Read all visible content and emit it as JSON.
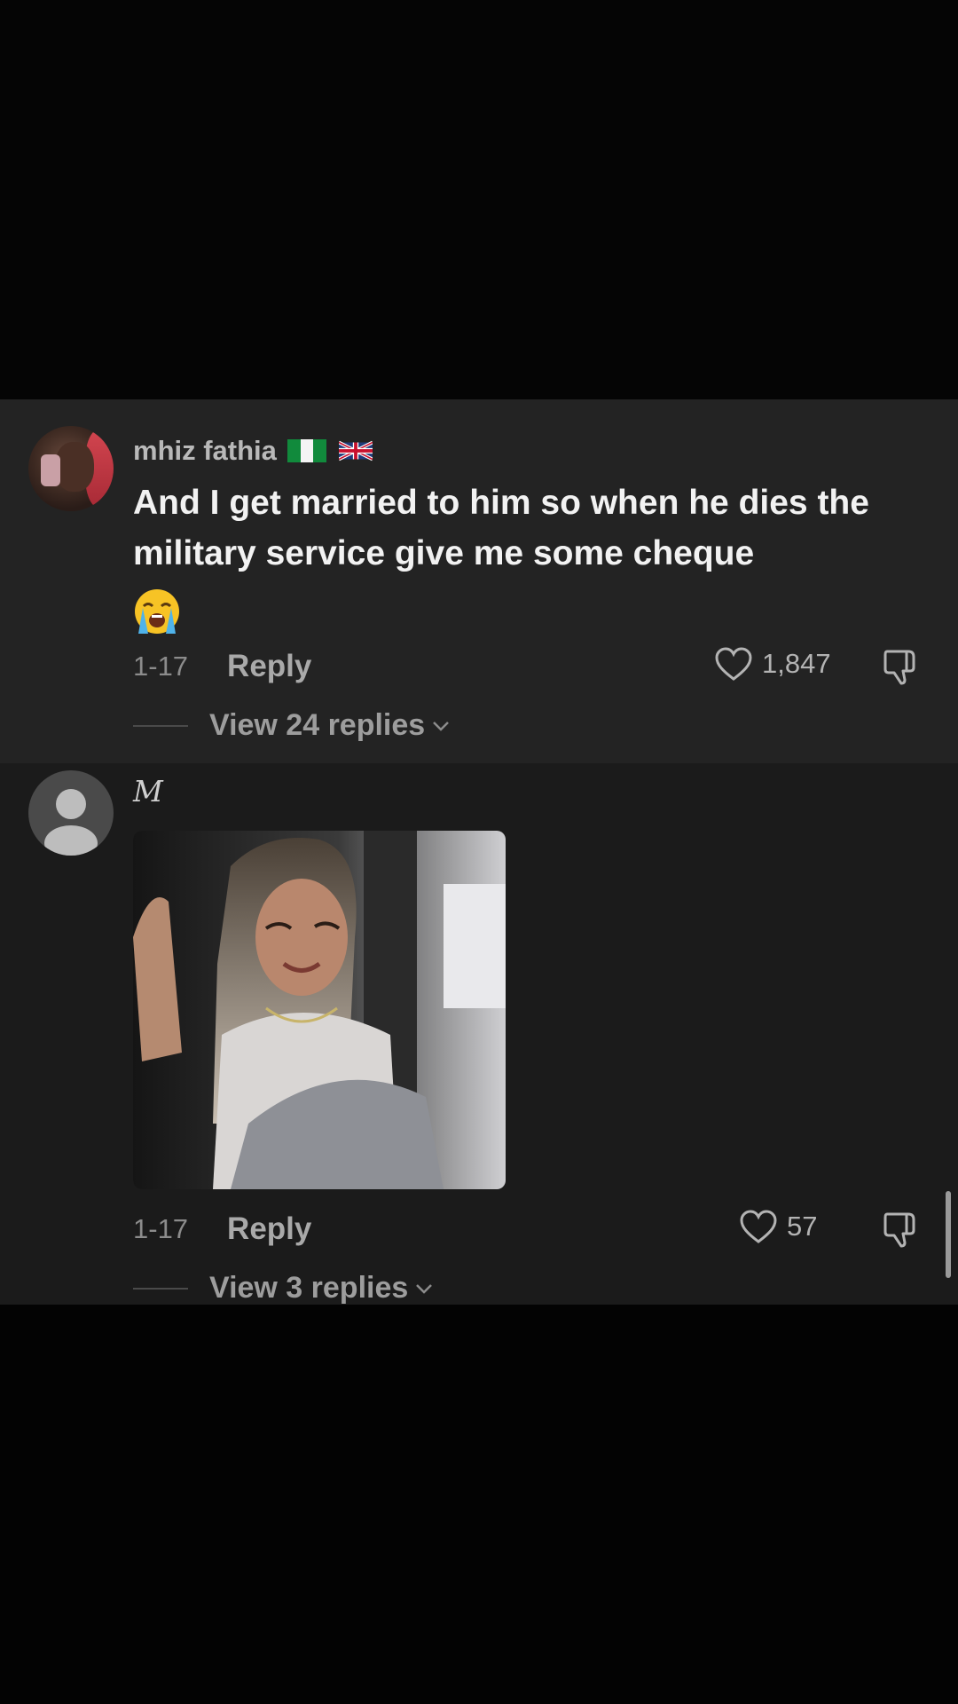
{
  "comments": [
    {
      "username": "mhiz fathia",
      "flags": [
        "nigeria-flag-icon",
        "uk-flag-icon"
      ],
      "text": "And I get married to him so when he dies the military service give me some cheque",
      "emoji": "loudly-crying-face-emoji",
      "date": "1-17",
      "reply_label": "Reply",
      "likes": "1,847",
      "view_replies": "View 24 replies"
    },
    {
      "username": "M",
      "media": "gif-woman-smiling",
      "date": "1-17",
      "reply_label": "Reply",
      "likes": "57",
      "view_replies": "View 3 replies"
    }
  ],
  "colors": {
    "background": "#000000",
    "panel": "#1b1b1b",
    "highlighted_comment": "#232323",
    "text_primary": "#f2f2f2",
    "text_secondary": "#8c8c8c"
  }
}
